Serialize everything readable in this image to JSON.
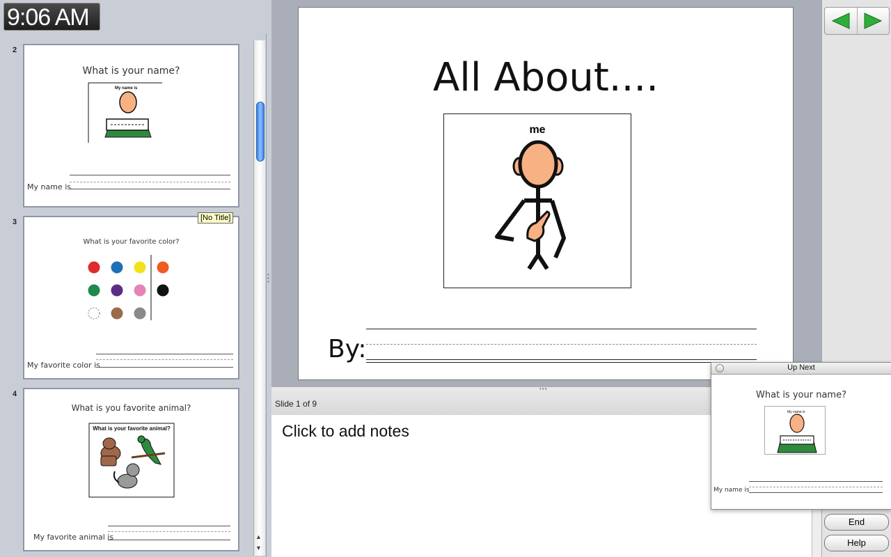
{
  "clock": {
    "time": "9:06 AM"
  },
  "thumbnails": [
    {
      "number": "2",
      "title": "What is your name?",
      "picture_caption": "My name is",
      "fill_label": "My name is"
    },
    {
      "number": "3",
      "title": "What is your favorite color?",
      "fill_label": "My favorite color is",
      "colors": [
        "#e02b2b",
        "#1f6fb5",
        "#f3e11a",
        "#f05a23",
        "#1f8a4c",
        "#5a2e85",
        "#e884b5",
        "#111111",
        "#ffffff",
        "#9a6b4a",
        "#8a8a8a"
      ]
    },
    {
      "number": "4",
      "title": "What is you favorite animal?",
      "picture_caption": "What is your favorite animal?",
      "fill_label": "My favorite animal is"
    }
  ],
  "tooltip": {
    "text": "[No Title]"
  },
  "slide": {
    "title": "All About....",
    "picture_label": "me",
    "by_label": "By:"
  },
  "notes": {
    "counter": "Slide 1 of 9",
    "placeholder": "Click to add notes"
  },
  "nav": {
    "prev_icon": "left-arrow-icon",
    "next_icon": "right-arrow-icon",
    "end_label": "End",
    "help_label": "Help",
    "accent": "#2fae3a"
  },
  "up_next": {
    "window_title": "Up Next",
    "question": "What is your name?",
    "picture_caption": "My name is",
    "fill_label": "My name is"
  }
}
